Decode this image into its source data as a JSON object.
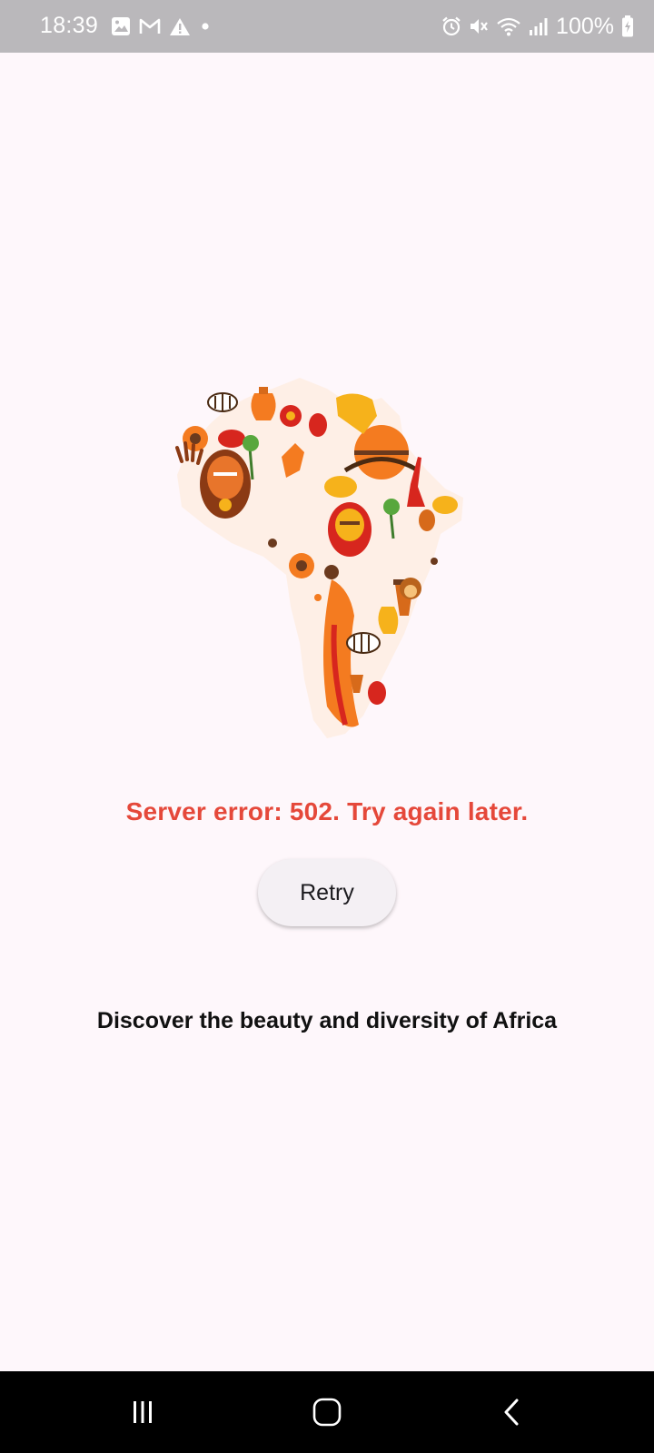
{
  "status_bar": {
    "time": "18:39",
    "battery": "100%",
    "left_icons": [
      "image-icon",
      "gmail-icon",
      "warning-icon",
      "dot-icon"
    ],
    "right_icons": [
      "alarm-icon",
      "mute-icon",
      "wifi-icon",
      "signal-icon",
      "battery-charging-icon"
    ]
  },
  "main": {
    "logo": "africa-map-logo",
    "error_message": "Server error: 502. Try again later.",
    "retry_label": "Retry",
    "tagline": "Discover the beauty and diversity of Africa"
  },
  "nav_bar": {
    "buttons": [
      "recents-icon",
      "home-icon",
      "back-icon"
    ]
  },
  "colors": {
    "background": "#fef7fb",
    "status_bar": "#bab8bb",
    "error": "#e5483a",
    "button_bg": "#f4f0f4",
    "logo_orange": "#f47b20",
    "logo_yellow": "#f6b21b",
    "logo_red": "#d7261e",
    "logo_brown": "#6b3a1e"
  }
}
